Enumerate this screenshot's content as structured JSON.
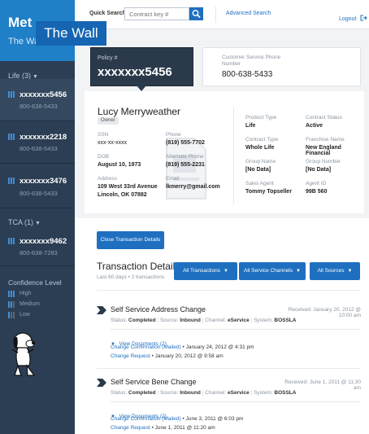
{
  "brand": {
    "name": "Met",
    "subtitle": "The Wa",
    "overlay": "The Wall"
  },
  "sidebar": {
    "life_header": "Life (3)",
    "tca_header": "TCA (1)",
    "life_accounts": [
      {
        "number": "xxxxxxx5456",
        "phone": "800-638-5433"
      },
      {
        "number": "xxxxxxx2218",
        "phone": "800-638-5433"
      },
      {
        "number": "xxxxxxx3476",
        "phone": "800-638-5433"
      }
    ],
    "tca_accounts": [
      {
        "number": "xxxxxxx9462",
        "phone": "800-638-7283"
      }
    ],
    "confidence": {
      "title": "Confidence Level",
      "high": "High",
      "medium": "Medium",
      "low": "Low"
    }
  },
  "topbar": {
    "quick_search_label": "Quick Search",
    "search_placeholder": "Contract key #",
    "advanced_search": "Advanced Search",
    "logout": "Logout"
  },
  "policy": {
    "label": "Policy #",
    "number": "xxxxxxx5456"
  },
  "customer_service": {
    "label": "Customer Service Phone Number",
    "phone": "800-638-5433"
  },
  "customer": {
    "name": "Lucy Merryweather",
    "role": "Owner",
    "ssn_label": "SSN",
    "ssn": "xxx-xx-xxxx",
    "phone_label": "Phone",
    "phone": "(819) 555-7702",
    "dob_label": "DOB",
    "dob": "August 10, 1973",
    "alt_phone_label": "Alternate Phone",
    "alt_phone": "(819) 555-2231",
    "address_label": "Address",
    "address_line1": "109 West 33rd Avenue",
    "address_line2": "Lincoln, OK 07882",
    "email_label": "Email",
    "email": "lkmerry@gmail.com"
  },
  "contract": {
    "product_type_label": "Product Type",
    "product_type": "Life",
    "status_label": "Contract Status",
    "status": "Active",
    "contract_type_label": "Contract Type",
    "contract_type": "Whole Life",
    "franchise_label": "Franchise Name",
    "franchise": "New England Financial",
    "group_name_label": "Group Name",
    "group_name": "[No Data]",
    "group_number_label": "Group Number",
    "group_number": "[No Data]",
    "sales_agent_label": "Sales Agent",
    "sales_agent": "Tommy Topseller",
    "agent_id_label": "Agent ID",
    "agent_id": "99B 560"
  },
  "close_button": "Close Transaction Details",
  "transactions": {
    "title": "Transaction Details",
    "subtitle": "Last 60 days • 2 transactions",
    "filters": [
      "All Transactions",
      "All Service Channels",
      "All Sources"
    ],
    "status_label": "Status:",
    "source_label": "Source:",
    "channel_label": "Channel:",
    "system_label": "System:",
    "items": [
      {
        "title": "Self Service Address Change",
        "received": "Received: January 20, 2012 @ 10:00 am",
        "status": "Completed",
        "source": "Inbound",
        "channel": "eService",
        "system": "BOSSLA",
        "view_docs": "View Documents (2)",
        "docs": [
          {
            "link": "Change Confirmation (Mailed)",
            "date": " • January 24, 2012 @ 4:31 pm"
          },
          {
            "link": "Change Request",
            "date": " • January 20, 2012 @ 9:58 am"
          }
        ]
      },
      {
        "title": "Self Service Bene Change",
        "received": "Received: June 1, 2011 @ 11:30 am",
        "status": "Completed",
        "source": "Inbound",
        "channel": "eService",
        "system": "BOSSLA",
        "view_docs": "View Documents (2)",
        "docs": [
          {
            "link": "Change Confirmation (Mailed)",
            "date": " • June 3, 2011 @ 6:03 pm"
          },
          {
            "link": "Change Request",
            "date": " • June 1, 2011 @ 11:20 am"
          }
        ]
      }
    ]
  }
}
